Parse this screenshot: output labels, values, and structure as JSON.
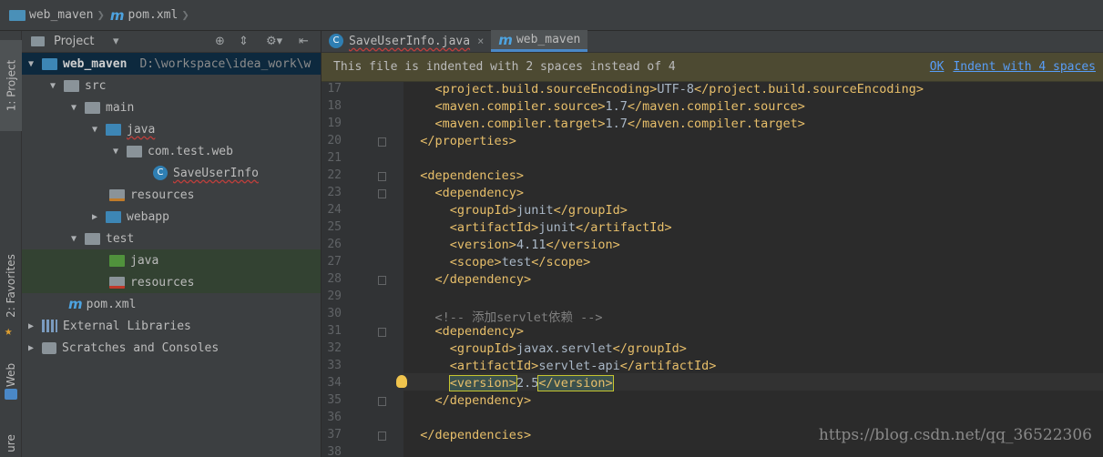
{
  "breadcrumb": {
    "project": "web_maven",
    "file": "pom.xml"
  },
  "side_tabs": {
    "project": "1: Project",
    "favorites": "2: Favorites",
    "web": "Web",
    "structure": "ure"
  },
  "project_panel": {
    "title": "Project"
  },
  "tree": [
    {
      "label": "web_maven",
      "path": "D:\\workspace\\idea_work\\w",
      "depth": 0,
      "icon": "module-folder-icon",
      "arrow": "down"
    },
    {
      "label": "src",
      "depth": 1,
      "icon": "folder-icon",
      "arrow": "down"
    },
    {
      "label": "main",
      "depth": 2,
      "icon": "folder-icon",
      "arrow": "down"
    },
    {
      "label": "java",
      "depth": 3,
      "icon": "source-folder-icon",
      "arrow": "down"
    },
    {
      "label": "com.test.web",
      "depth": 4,
      "icon": "package-icon",
      "arrow": "down"
    },
    {
      "label": "SaveUserInfo",
      "depth": 5,
      "icon": "class-icon",
      "arrow": ""
    },
    {
      "label": "resources",
      "depth": 3,
      "icon": "resources-folder-icon",
      "arrow": ""
    },
    {
      "label": "webapp",
      "depth": 3,
      "icon": "web-folder-icon",
      "arrow": "right"
    },
    {
      "label": "test",
      "depth": 2,
      "icon": "folder-icon",
      "arrow": "down"
    },
    {
      "label": "java",
      "depth": 3,
      "icon": "test-source-folder-icon",
      "arrow": ""
    },
    {
      "label": "resources",
      "depth": 3,
      "icon": "test-resources-folder-icon",
      "arrow": ""
    },
    {
      "label": "pom.xml",
      "depth": 1,
      "icon": "maven-icon",
      "arrow": ""
    },
    {
      "label": "External Libraries",
      "depth": 0,
      "icon": "libraries-icon",
      "arrow": "right"
    },
    {
      "label": "Scratches and Consoles",
      "depth": 0,
      "icon": "scratches-icon",
      "arrow": "right"
    }
  ],
  "tabs": [
    {
      "label": "SaveUserInfo.java",
      "icon": "C",
      "close": "×"
    },
    {
      "label": "web_maven",
      "icon": "m"
    }
  ],
  "notice": {
    "text": "This file is indented with 2 spaces instead of 4",
    "ok": "OK",
    "indent": "Indent with 4 spaces"
  },
  "lines": [
    {
      "n": "17",
      "text": "    <project.build.sourceEncoding>UTF-8</project.build.sourceEncoding>"
    },
    {
      "n": "18",
      "text": "    <maven.compiler.source>1.7</maven.compiler.source>"
    },
    {
      "n": "19",
      "text": "    <maven.compiler.target>1.7</maven.compiler.target>"
    },
    {
      "n": "20",
      "text": "  </properties>"
    },
    {
      "n": "21",
      "text": ""
    },
    {
      "n": "22",
      "text": "  <dependencies>"
    },
    {
      "n": "23",
      "text": "    <dependency>"
    },
    {
      "n": "24",
      "text": "      <groupId>junit</groupId>"
    },
    {
      "n": "25",
      "text": "      <artifactId>junit</artifactId>"
    },
    {
      "n": "26",
      "text": "      <version>4.11</version>"
    },
    {
      "n": "27",
      "text": "      <scope>test</scope>"
    },
    {
      "n": "28",
      "text": "    </dependency>"
    },
    {
      "n": "29",
      "text": ""
    },
    {
      "n": "30",
      "text": "    <!-- 添加servlet依赖 -->"
    },
    {
      "n": "31",
      "text": "    <dependency>"
    },
    {
      "n": "32",
      "text": "      <groupId>javax.servlet</groupId>"
    },
    {
      "n": "33",
      "text": "      <artifactId>servlet-api</artifactId>"
    },
    {
      "n": "34",
      "text": "      <version>2.5</version>"
    },
    {
      "n": "35",
      "text": "    </dependency>"
    },
    {
      "n": "36",
      "text": ""
    },
    {
      "n": "37",
      "text": "  </dependencies>"
    },
    {
      "n": "38",
      "text": ""
    }
  ],
  "watermark": "https://blog.csdn.net/qq_36522306"
}
